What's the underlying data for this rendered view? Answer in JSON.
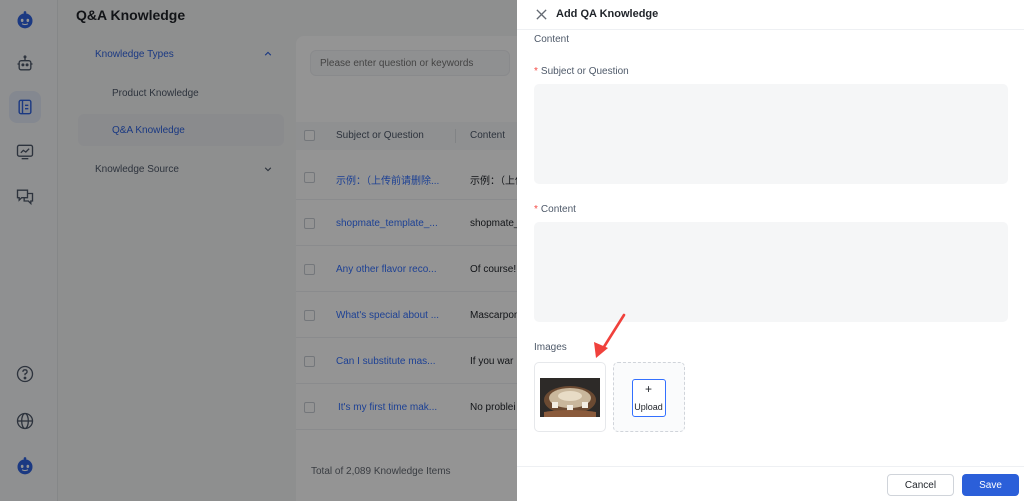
{
  "page": {
    "title": "Q&A Knowledge"
  },
  "rail": {
    "icons": [
      "bot-logo-icon",
      "robot-icon",
      "knowledge-book-icon",
      "monitor-chart-icon",
      "chat-bubbles-icon",
      "help-circle-icon",
      "globe-icon",
      "user-bot-avatar-icon"
    ],
    "active_index": 2
  },
  "subnav": {
    "types_label": "Knowledge Types",
    "product_label": "Product Knowledge",
    "qa_label": "Q&A Knowledge",
    "source_label": "Knowledge Source"
  },
  "list": {
    "search_placeholder": "Please enter question or keywords",
    "col_subject": "Subject or Question",
    "col_content": "Content",
    "rows": [
      {
        "subject": "示例：（上传前请删除...",
        "content": "示例：（上传"
      },
      {
        "subject": "shopmate_template_...",
        "content": "shopmate_"
      },
      {
        "subject": "Any other flavor reco...",
        "content": "Of course!"
      },
      {
        "subject": "What's special about ...",
        "content": "Mascarpon"
      },
      {
        "subject": "Can I substitute mas...",
        "content": "If you war"
      },
      {
        "subject": "It's my first time mak...",
        "content": "No problei"
      }
    ],
    "total_text": "Total of 2,089 Knowledge Items"
  },
  "drawer": {
    "title": "Add QA Knowledge",
    "section_label": "Content",
    "subject_label": "Subject or Question",
    "subject_value": "",
    "content_label": "Content",
    "content_value": "",
    "required_mark": "*",
    "images_label": "Images",
    "upload_plus": "+",
    "upload_label": "Upload",
    "cancel_label": "Cancel",
    "save_label": "Save"
  },
  "colors": {
    "accent": "#2b5fd9",
    "link": "#3370ff",
    "required": "#f54a45",
    "annotation_arrow": "#f0413c"
  }
}
